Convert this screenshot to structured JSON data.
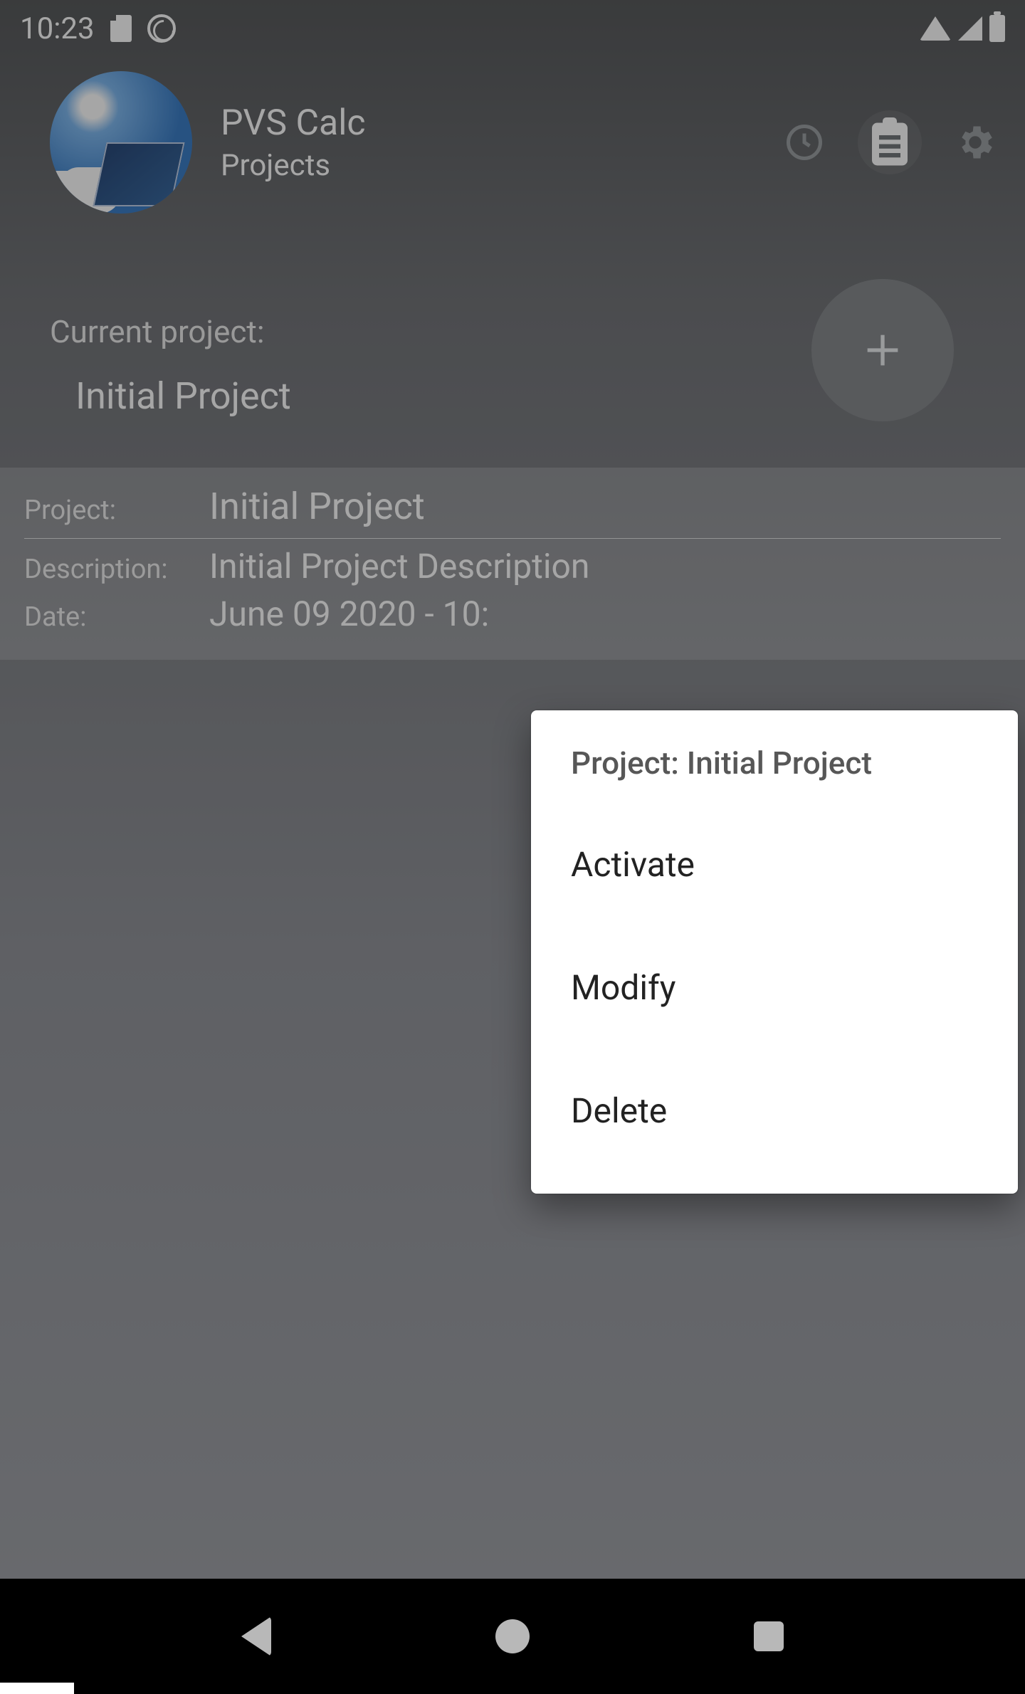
{
  "status": {
    "time": "10:23"
  },
  "app": {
    "title": "PVS Calc",
    "subtitle": "Projects"
  },
  "current": {
    "label": "Current project:",
    "name": "Initial Project"
  },
  "card": {
    "project_label": "Project:",
    "project_value": "Initial Project",
    "description_label": "Description:",
    "description_value": "Initial Project Description",
    "date_label": "Date:",
    "date_value": "June 09 2020 - 10:"
  },
  "popup": {
    "title": "Project: Initial Project",
    "items": [
      "Activate",
      "Modify",
      "Delete"
    ]
  }
}
